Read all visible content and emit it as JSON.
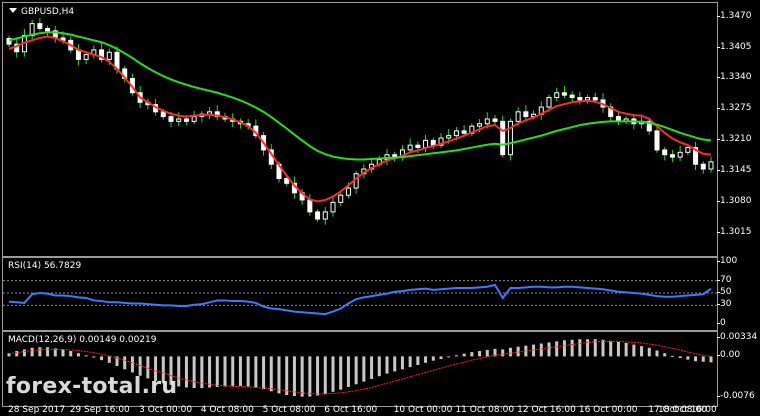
{
  "chart_data": [
    {
      "type": "candlestick",
      "title": "GBPUSD,H4",
      "ylim": [
        1.298,
        1.349
      ],
      "y_ticks": [
        "1.3470",
        "1.3405",
        "1.3340",
        "1.3275",
        "1.3210",
        "1.3145",
        "1.3080",
        "1.3015"
      ],
      "x_ticks": [
        "28 Sep 2017",
        "29 Sep 16:00",
        "3 Oct 00:00",
        "4 Oct 08:00",
        "5 Oct 08:00",
        "6 Oct 16:00",
        "10 Oct 00:00",
        "11 Oct 08:00",
        "12 Oct 16:00",
        "16 Oct 00:00",
        "17 Oct 08:00",
        "18 Oct 16:00"
      ],
      "closes": [
        1.3412,
        1.3396,
        1.343,
        1.3455,
        1.3445,
        1.344,
        1.3425,
        1.342,
        1.34,
        1.338,
        1.339,
        1.34,
        1.338,
        1.3395,
        1.336,
        1.334,
        1.331,
        1.329,
        1.3285,
        1.327,
        1.326,
        1.325,
        1.3255,
        1.325,
        1.326,
        1.3265,
        1.327,
        1.326,
        1.3255,
        1.325,
        1.3245,
        1.324,
        1.322,
        1.319,
        1.316,
        1.313,
        1.312,
        1.31,
        1.3085,
        1.306,
        1.3045,
        1.306,
        1.308,
        1.3095,
        1.311,
        1.314,
        1.315,
        1.316,
        1.317,
        1.318,
        1.3175,
        1.319,
        1.32,
        1.3195,
        1.321,
        1.32,
        1.3215,
        1.322,
        1.323,
        1.3225,
        1.324,
        1.3245,
        1.3255,
        1.325,
        1.318,
        1.325,
        1.327,
        1.326,
        1.3265,
        1.328,
        1.33,
        1.331,
        1.3305,
        1.33,
        1.3295,
        1.33,
        1.3295,
        1.328,
        1.326,
        1.325,
        1.3255,
        1.3245,
        1.325,
        1.323,
        1.319,
        1.318,
        1.3175,
        1.3185,
        1.3195,
        1.316,
        1.315,
        1.3165
      ],
      "series": [
        {
          "color": "#ff2a2a",
          "values": [
            1.3402,
            1.3408,
            1.3415,
            1.342,
            1.3425,
            1.3428,
            1.3425,
            1.3418,
            1.341,
            1.34,
            1.3395,
            1.339,
            1.3385,
            1.3375,
            1.336,
            1.3342,
            1.3322,
            1.33,
            1.329,
            1.328,
            1.3272,
            1.3266,
            1.3262,
            1.326,
            1.3262,
            1.3263,
            1.3264,
            1.3262,
            1.3259,
            1.3254,
            1.3248,
            1.324,
            1.3226,
            1.3205,
            1.3182,
            1.3158,
            1.3136,
            1.3115,
            1.3099,
            1.3086,
            1.3082,
            1.3085,
            1.3092,
            1.3103,
            1.3116,
            1.313,
            1.3142,
            1.3152,
            1.316,
            1.3168,
            1.3172,
            1.3178,
            1.3185,
            1.3189,
            1.3194,
            1.3198,
            1.3203,
            1.3208,
            1.3214,
            1.322,
            1.3227,
            1.3233,
            1.324,
            1.3242,
            1.323,
            1.3236,
            1.3246,
            1.3252,
            1.3258,
            1.3266,
            1.3274,
            1.3282,
            1.3286,
            1.329,
            1.3292,
            1.3293,
            1.3291,
            1.3286,
            1.3278,
            1.327,
            1.3266,
            1.3263,
            1.3262,
            1.3255,
            1.324,
            1.3226,
            1.3214,
            1.3206,
            1.32,
            1.319,
            1.3182,
            1.318
          ]
        },
        {
          "color": "#23e01f",
          "values": [
            1.342,
            1.3424,
            1.3428,
            1.3432,
            1.3435,
            1.3437,
            1.3437,
            1.3435,
            1.3432,
            1.3428,
            1.3424,
            1.342,
            1.3416,
            1.341,
            1.3402,
            1.3393,
            1.3383,
            1.3372,
            1.3362,
            1.3353,
            1.3345,
            1.3338,
            1.3332,
            1.3327,
            1.3322,
            1.3318,
            1.3314,
            1.331,
            1.3305,
            1.33,
            1.3294,
            1.3287,
            1.3279,
            1.327,
            1.3259,
            1.3247,
            1.3235,
            1.3222,
            1.321,
            1.3198,
            1.3188,
            1.3181,
            1.3176,
            1.3173,
            1.3171,
            1.317,
            1.317,
            1.3171,
            1.3172,
            1.3173,
            1.3174,
            1.3175,
            1.3177,
            1.3179,
            1.3181,
            1.3183,
            1.3185,
            1.3187,
            1.3189,
            1.3192,
            1.3195,
            1.3198,
            1.3201,
            1.3203,
            1.3201,
            1.3204,
            1.3208,
            1.3212,
            1.3216,
            1.322,
            1.3225,
            1.323,
            1.3234,
            1.3238,
            1.3242,
            1.3245,
            1.3247,
            1.3249,
            1.325,
            1.325,
            1.325,
            1.325,
            1.3249,
            1.3247,
            1.3243,
            1.3238,
            1.3232,
            1.3226,
            1.3221,
            1.3216,
            1.3212,
            1.321
          ]
        }
      ]
    },
    {
      "type": "line",
      "title": "RSI(14) 56.7829",
      "ylim": [
        0,
        100
      ],
      "y_ticks": [
        "100",
        "70",
        "50",
        "30",
        "0"
      ],
      "levels": [
        70,
        50,
        30
      ],
      "series": [
        {
          "color": "#3a7bff",
          "values": [
            36,
            35,
            34,
            48,
            50,
            49,
            46,
            46,
            45,
            43,
            42,
            38,
            37,
            35,
            35,
            34,
            33,
            33,
            32,
            31,
            30,
            30,
            29,
            29,
            31,
            32,
            35,
            38,
            38,
            37,
            37,
            36,
            34,
            28,
            25,
            24,
            22,
            20,
            19,
            18,
            17,
            16,
            20,
            25,
            33,
            40,
            43,
            45,
            47,
            49,
            52,
            53,
            55,
            56,
            57,
            55,
            56,
            57,
            58,
            58,
            58,
            59,
            60,
            63,
            42,
            58,
            58,
            59,
            60,
            60,
            59,
            59,
            60,
            60,
            59,
            58,
            57,
            56,
            54,
            52,
            51,
            50,
            49,
            47,
            45,
            44,
            44,
            45,
            46,
            47,
            48,
            57
          ]
        }
      ]
    },
    {
      "type": "bar",
      "title": "MACD(12,26,9) 0.00149 0.00219",
      "ylim": [
        -0.0085,
        0.0038
      ],
      "y_ticks": [
        "0.00334",
        "0.00",
        "-0.0076"
      ],
      "values": [
        0.0006,
        0.001,
        0.0013,
        0.0016,
        0.0017,
        0.0017,
        0.0015,
        0.0013,
        0.001,
        0.0006,
        0.0002,
        -0.0002,
        -0.0007,
        -0.0012,
        -0.0018,
        -0.0024,
        -0.003,
        -0.0036,
        -0.0041,
        -0.0046,
        -0.005,
        -0.0053,
        -0.0056,
        -0.0058,
        -0.0059,
        -0.0059,
        -0.0058,
        -0.0057,
        -0.0056,
        -0.0055,
        -0.0055,
        -0.0056,
        -0.0058,
        -0.0061,
        -0.0065,
        -0.0069,
        -0.0072,
        -0.0074,
        -0.0075,
        -0.0075,
        -0.0073,
        -0.007,
        -0.0066,
        -0.0062,
        -0.0057,
        -0.0052,
        -0.0047,
        -0.0042,
        -0.0037,
        -0.0032,
        -0.0028,
        -0.0024,
        -0.002,
        -0.0016,
        -0.0012,
        -0.0008,
        -0.0005,
        -0.0001,
        0.0002,
        0.0005,
        0.0008,
        0.001,
        0.0012,
        0.0014,
        0.0013,
        0.0016,
        0.0018,
        0.002,
        0.0022,
        0.0024,
        0.0026,
        0.0028,
        0.003,
        0.0031,
        0.0032,
        0.0032,
        0.0032,
        0.0031,
        0.0029,
        0.0027,
        0.0025,
        0.0022,
        0.0019,
        0.0016,
        0.0011,
        0.0006,
        0.0001,
        -0.0003,
        -0.0006,
        -0.0009,
        -0.001,
        -0.0011
      ],
      "signal": [
        0.0005,
        0.0007,
        0.0009,
        0.0011,
        0.0012,
        0.0013,
        0.0013,
        0.0013,
        0.0012,
        0.0011,
        0.0009,
        0.0007,
        0.0004,
        0.0001,
        -0.0003,
        -0.0007,
        -0.0012,
        -0.0017,
        -0.0022,
        -0.0027,
        -0.0031,
        -0.0036,
        -0.004,
        -0.0044,
        -0.0047,
        -0.005,
        -0.0052,
        -0.0054,
        -0.0055,
        -0.0056,
        -0.0056,
        -0.0057,
        -0.0058,
        -0.0059,
        -0.006,
        -0.0062,
        -0.0064,
        -0.0066,
        -0.0068,
        -0.0069,
        -0.007,
        -0.007,
        -0.0069,
        -0.0068,
        -0.0066,
        -0.0064,
        -0.0061,
        -0.0058,
        -0.0054,
        -0.005,
        -0.0046,
        -0.0042,
        -0.0038,
        -0.0034,
        -0.003,
        -0.0026,
        -0.0022,
        -0.0018,
        -0.0014,
        -0.0011,
        -0.0007,
        -0.0004,
        -0.0001,
        0.0002,
        0.0004,
        0.0006,
        0.0008,
        0.001,
        0.0012,
        0.0014,
        0.0016,
        0.0018,
        0.002,
        0.0022,
        0.0024,
        0.0026,
        0.0027,
        0.0028,
        0.0028,
        0.0028,
        0.0027,
        0.0026,
        0.0025,
        0.0023,
        0.0021,
        0.0018,
        0.0015,
        0.0012,
        0.0008,
        0.0005,
        0.0002,
        0.0
      ],
      "bar_color": "#c8c8c8",
      "signal_color": "#ff2020"
    }
  ],
  "watermark": "forex-total.ru",
  "colors": {
    "background": "#000000",
    "up_candle": "#ffffff",
    "down_candle": "#ffffff",
    "wick": "#23e01f",
    "axis": "#9a9a9a",
    "level": "#8a8a8a"
  }
}
